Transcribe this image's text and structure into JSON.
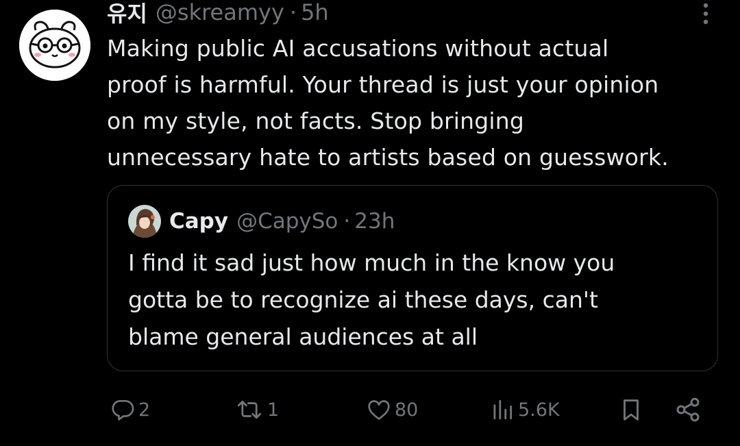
{
  "tweet": {
    "author": {
      "display_name": "유지",
      "handle": "@skreamyy",
      "separator": "·",
      "time": "5h"
    },
    "text": "Making public AI accusations without actual\nproof is harmful. Your thread is just your opinion\non my style, not facts. Stop bringing\nunnecessary hate to artists based on guesswork.",
    "more_icon": "more-vertical-icon"
  },
  "quoted_tweet": {
    "author": {
      "display_name": "Capy",
      "handle": "@CapySo",
      "separator": "·",
      "time": "23h"
    },
    "text": "I find it sad just how much in the know you\ngotta be to recognize ai these days, can't\nblame general audiences at all"
  },
  "actions": {
    "reply": {
      "icon": "reply-icon",
      "count": "2"
    },
    "retweet": {
      "icon": "retweet-icon",
      "count": "1"
    },
    "like": {
      "icon": "heart-icon",
      "count": "80"
    },
    "views": {
      "icon": "views-icon",
      "count": "5.6K"
    },
    "bookmark": {
      "icon": "bookmark-icon"
    },
    "share": {
      "icon": "share-icon"
    }
  },
  "colors": {
    "background": "#000000",
    "text": "#e7e9ea",
    "muted": "#71767b",
    "border": "#2f3336"
  }
}
